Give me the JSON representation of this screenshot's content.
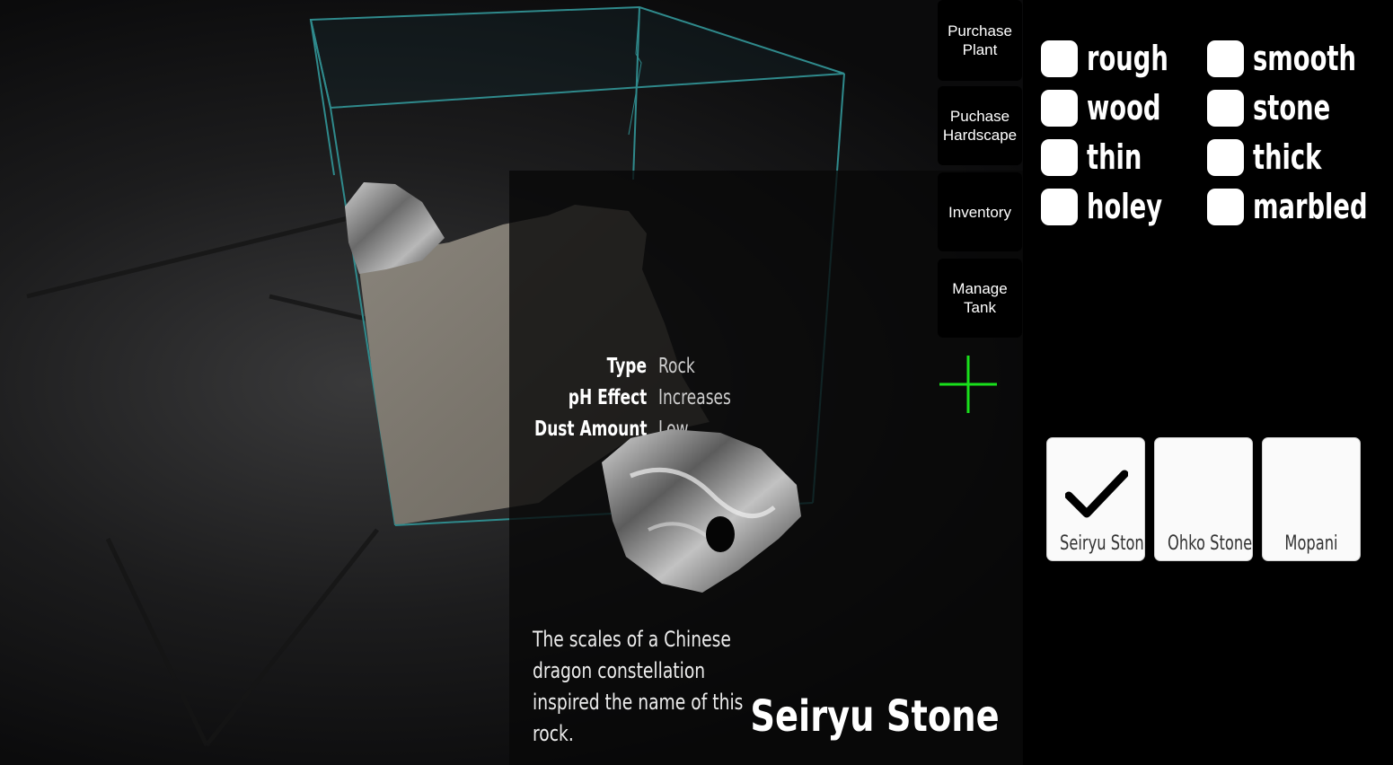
{
  "menu": {
    "purchase_plant": "Purchase\nPlant",
    "purchase_hardscape": "Puchase\nHardscape",
    "inventory": "Inventory",
    "manage_tank": "Manage\nTank"
  },
  "info": {
    "rows": [
      {
        "label": "Type",
        "value": "Rock"
      },
      {
        "label": "pH Effect",
        "value": "Increases"
      },
      {
        "label": "Dust Amount",
        "value": "Low"
      }
    ],
    "description_lines": [
      "The scales of a Chinese",
      "dragon constellation",
      "inspired the name of this",
      "rock."
    ],
    "title": "Seiryu Stone"
  },
  "filters": [
    {
      "label": "rough",
      "checked": false
    },
    {
      "label": "smooth",
      "checked": false
    },
    {
      "label": "wood",
      "checked": false
    },
    {
      "label": "stone",
      "checked": false
    },
    {
      "label": "thin",
      "checked": false
    },
    {
      "label": "thick",
      "checked": false
    },
    {
      "label": "holey",
      "checked": false
    },
    {
      "label": "marbled",
      "checked": false
    }
  ],
  "items": [
    {
      "label": "Seiryu Stone",
      "selected": true
    },
    {
      "label": "Ohko Stone",
      "selected": false
    },
    {
      "label": "Mopani",
      "selected": false
    }
  ],
  "colors": {
    "tank_edge": "#2f8a8c",
    "crosshair": "#19e01c"
  }
}
